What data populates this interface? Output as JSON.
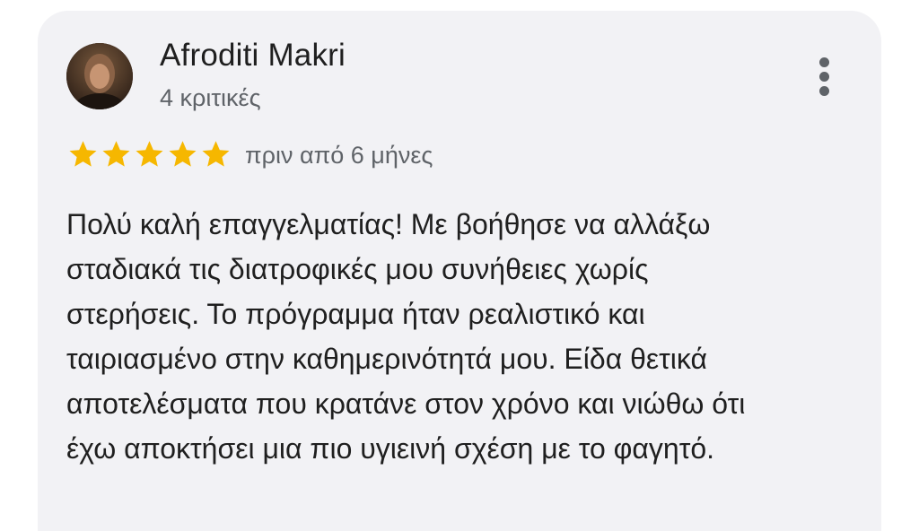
{
  "review": {
    "reviewer_name": "Afroditi Makri",
    "review_count": "4 κριτικές",
    "rating": 5,
    "rating_max": 5,
    "date": "πριν από 6 μήνες",
    "text_lines": [
      "Πολύ καλή επαγγελματίας! Με βοήθησε να αλλάξω",
      "σταδιακά τις διατροφικές μου συνήθειες χωρίς",
      "στερήσεις. Το πρόγραμμα ήταν ρεαλιστικό και",
      "ταιριασμένο στην καθημερινότητά μου. Είδα θετικά",
      "αποτελέσματα που κρατάνε στον χρόνο και νιώθω ότι",
      "έχω αποκτήσει μια πιο υγιεινή σχέση με το φαγητό."
    ]
  },
  "icons": {
    "menu": "more-vertical-icon",
    "star": "star-icon"
  },
  "colors": {
    "card_background": "#f2f2f5",
    "star": "#f6b700",
    "primary_text": "#1f1f1f",
    "secondary_text": "#5f6368"
  }
}
